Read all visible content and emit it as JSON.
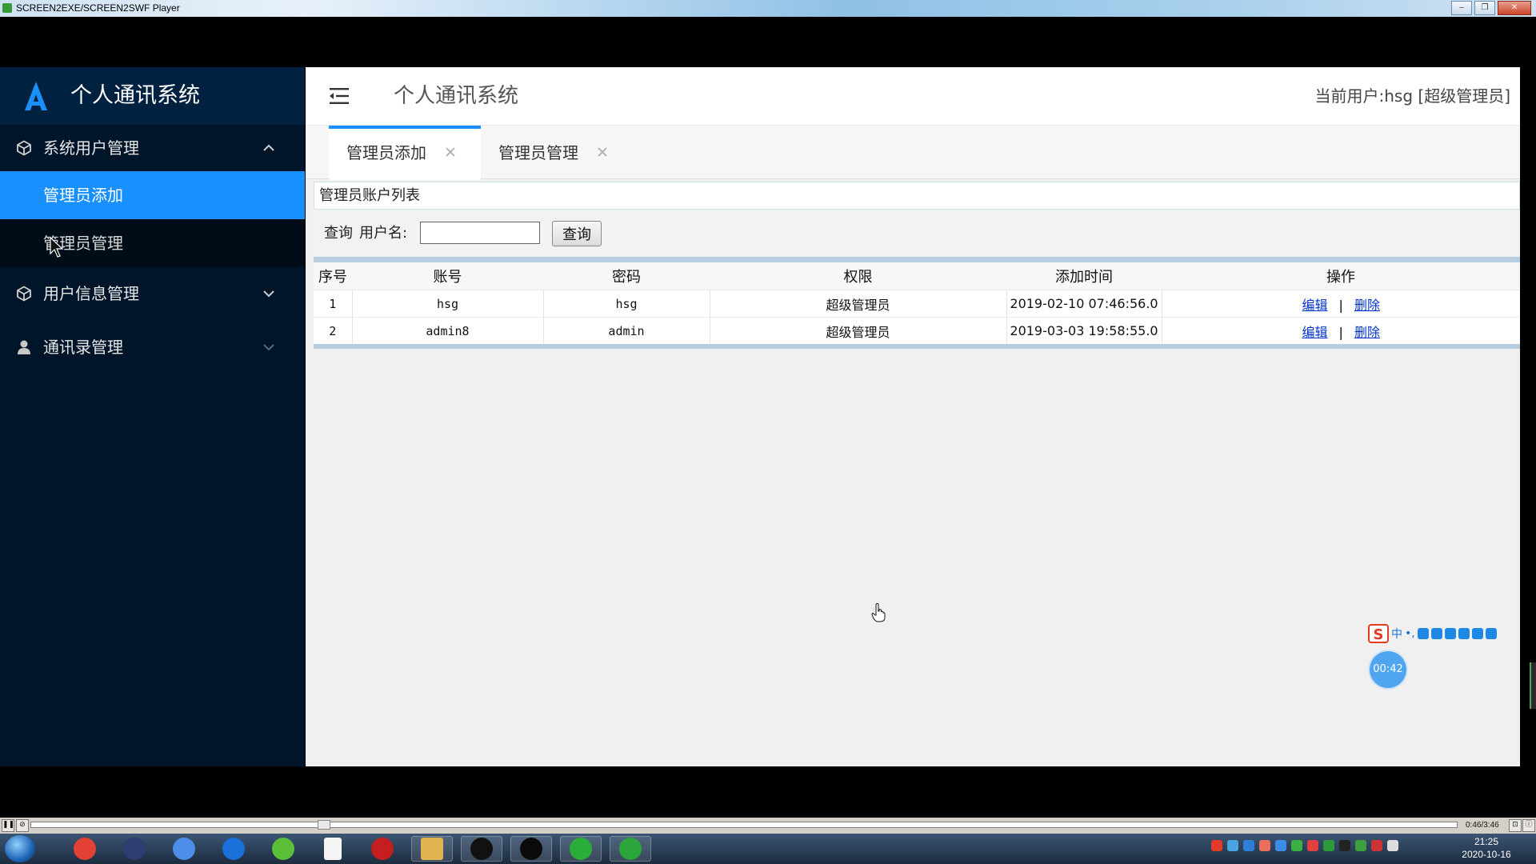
{
  "player": {
    "title": "SCREEN2EXE/SCREEN2SWF Player",
    "window_buttons": [
      "‒",
      "❐",
      "✕"
    ],
    "time": "0:46/3:46",
    "progress": 0.203
  },
  "app": {
    "brand": "个人通讯系统",
    "sidebar": {
      "groups": [
        {
          "label": "系统用户管理",
          "icon": "cube-icon",
          "expanded": true,
          "items": [
            {
              "label": "管理员添加",
              "active": true
            },
            {
              "label": "管理员管理",
              "active": false
            }
          ]
        },
        {
          "label": "用户信息管理",
          "icon": "cube-icon",
          "expanded": false
        },
        {
          "label": "通讯录管理",
          "icon": "user-icon",
          "expanded": false
        }
      ]
    },
    "header": {
      "title": "个人通讯系统",
      "current_user": "当前用户:hsg [超级管理员]"
    },
    "tabs": [
      {
        "label": "管理员添加",
        "active": true
      },
      {
        "label": "管理员管理",
        "active": false
      }
    ],
    "panel": {
      "title": "管理员账户列表",
      "search": {
        "label": "查询",
        "field_label": "用户名:",
        "value": "",
        "button": "查询"
      },
      "table": {
        "columns": [
          "序号",
          "账号",
          "密码",
          "权限",
          "添加时间",
          "操作"
        ],
        "rows": [
          {
            "no": "1",
            "account": "hsg",
            "password": "hsg",
            "role": "超级管理员",
            "time": "2019-02-10 07:46:56.0"
          },
          {
            "no": "2",
            "account": "admin8",
            "password": "admin",
            "role": "超级管理员",
            "time": "2019-03-03 19:58:55.0"
          }
        ],
        "actions": {
          "edit": "编辑",
          "separator": "|",
          "delete": "删除"
        }
      }
    }
  },
  "overlay": {
    "ime_mode": "中",
    "ime_punct": "•,",
    "timer": "00:42"
  },
  "taskbar": {
    "clock_time": "21:25",
    "clock_date": "2020-10-16",
    "app_icons": [
      "chrome-icon",
      "eclipse-icon",
      "baidu-netdisk-icon",
      "qq-browser-icon",
      "360-icon",
      "notepad-icon",
      "flash-icon",
      "file-explorer-icon",
      "qq-icon",
      "app-icon",
      "wechat-icon",
      "screen-recorder-icon"
    ]
  }
}
